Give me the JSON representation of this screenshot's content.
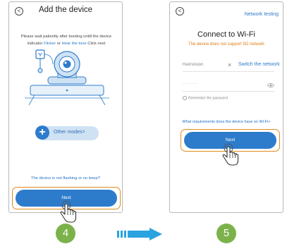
{
  "screen1": {
    "back_glyph": "<",
    "title": "Add the device",
    "instruction_part1": "Please wait patiently after booting untill the device indicator ",
    "flicker": "Flicker",
    "instruction_or": " or ",
    "hear_tone": "Hear the tone",
    "instruction_part2": " Click next",
    "other_modes_plus": "+",
    "other_modes_label": "Other modes>",
    "no_beep_link": "The device is not flashing or no beep?",
    "next_label": "Next"
  },
  "screen2": {
    "back_glyph": "<",
    "network_testing": "Network testing",
    "title": "Connect to Wi-Fi",
    "warning": "The device does not support 5G network",
    "ssid_value": "Heimvision",
    "clear_glyph": "×",
    "switch_network": "Switch the network",
    "password_value": "·······",
    "remember_password": "Remember the password",
    "requirements_link": "What requirements does the device have on Wi-Fi>",
    "next_label": "Next"
  },
  "steps": [
    "4",
    "5"
  ],
  "colors": {
    "primary_blue": "#2d7ccc",
    "highlight_orange": "#e08a1e",
    "step_green": "#7bb24a",
    "arrow_blue": "#2aa3e0"
  }
}
